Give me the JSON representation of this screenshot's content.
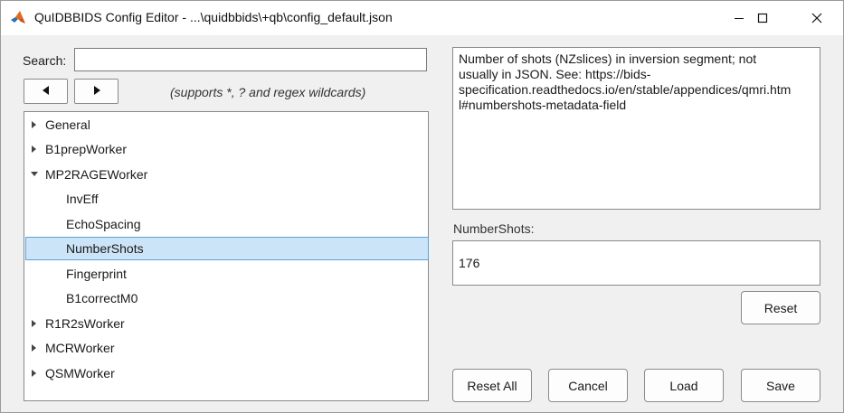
{
  "window": {
    "title": "QuIDBBIDS Config Editor - ...\\quidbbids\\+qb\\config_default.json",
    "controls": [
      "minimize-icon",
      "maximize-icon",
      "close-icon"
    ]
  },
  "search": {
    "label": "Search:",
    "value": "",
    "hint": "(supports *, ? and regex wildcards)",
    "back_icon": "triangle-left-icon",
    "forward_icon": "triangle-right-icon"
  },
  "tree": {
    "items": [
      {
        "label": "General",
        "level": 0,
        "expandable": true,
        "expanded": false,
        "selected": false
      },
      {
        "label": "B1prepWorker",
        "level": 0,
        "expandable": true,
        "expanded": false,
        "selected": false
      },
      {
        "label": "MP2RAGEWorker",
        "level": 0,
        "expandable": true,
        "expanded": true,
        "selected": false
      },
      {
        "label": "InvEff",
        "level": 1,
        "expandable": false,
        "expanded": false,
        "selected": false
      },
      {
        "label": "EchoSpacing",
        "level": 1,
        "expandable": false,
        "expanded": false,
        "selected": false
      },
      {
        "label": "NumberShots",
        "level": 1,
        "expandable": false,
        "expanded": false,
        "selected": true
      },
      {
        "label": "Fingerprint",
        "level": 1,
        "expandable": false,
        "expanded": false,
        "selected": false
      },
      {
        "label": "B1correctM0",
        "level": 1,
        "expandable": false,
        "expanded": false,
        "selected": false
      },
      {
        "label": "R1R2sWorker",
        "level": 0,
        "expandable": true,
        "expanded": false,
        "selected": false
      },
      {
        "label": "MCRWorker",
        "level": 0,
        "expandable": true,
        "expanded": false,
        "selected": false
      },
      {
        "label": "QSMWorker",
        "level": 0,
        "expandable": true,
        "expanded": false,
        "selected": false
      }
    ]
  },
  "description": {
    "lines": [
      "Number of shots (NZslices) in inversion segment; not",
      "usually in JSON. See: https://bids-",
      "specification.readthedocs.io/en/stable/appendices/qmri.htm",
      "l#numbershots-metadata-field"
    ]
  },
  "field": {
    "label": "NumberShots:",
    "value": "176"
  },
  "buttons": {
    "reset": "Reset",
    "reset_all": "Reset All",
    "cancel": "Cancel",
    "load": "Load",
    "save": "Save"
  },
  "colors": {
    "selection_bg": "#cce4f7",
    "selection_border": "#5ea3d8",
    "window_bg": "#f0f0f0"
  }
}
